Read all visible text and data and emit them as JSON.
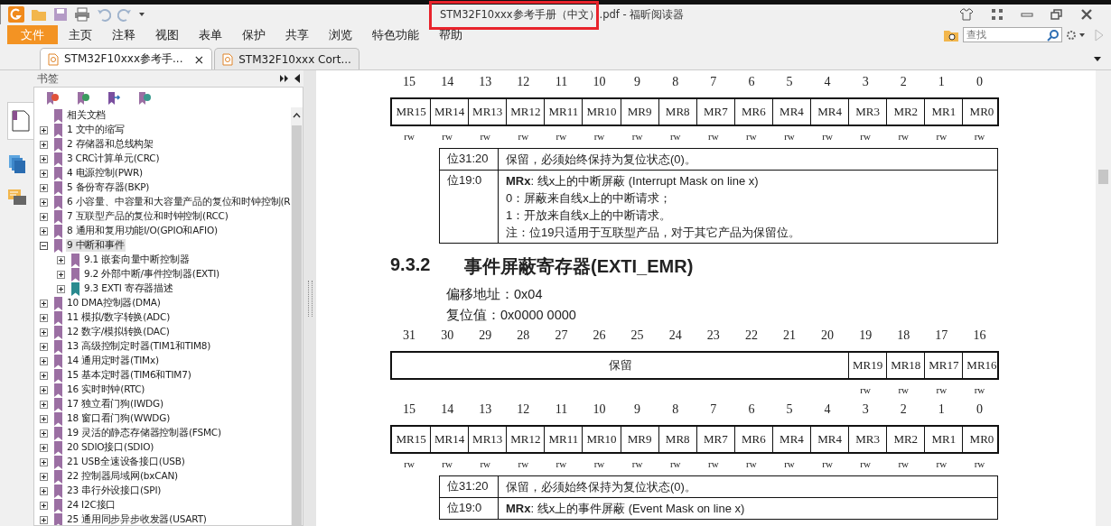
{
  "window": {
    "title": "STM32F10xxx参考手册（中文）.pdf - 福昕阅读器"
  },
  "menu": [
    {
      "label": "文件",
      "kind": "file",
      "selected": false
    },
    {
      "label": "主页",
      "kind": "tab",
      "selected": false
    },
    {
      "label": "注释",
      "kind": "tab",
      "selected": false
    },
    {
      "label": "视图",
      "kind": "tab",
      "selected": false
    },
    {
      "label": "表单",
      "kind": "tab",
      "selected": false
    },
    {
      "label": "保护",
      "kind": "tab",
      "selected": false
    },
    {
      "label": "共享",
      "kind": "tab",
      "selected": false
    },
    {
      "label": "浏览",
      "kind": "tab",
      "selected": false
    },
    {
      "label": "特色功能",
      "kind": "tab",
      "selected": false
    },
    {
      "label": "帮助",
      "kind": "tab",
      "selected": false
    }
  ],
  "search": {
    "placeholder": "查找"
  },
  "doc_tabs": [
    {
      "label": "STM32F10xxx参考手...",
      "selected": true,
      "close": "×"
    },
    {
      "label": "STM32F10xxx Cort...",
      "selected": false
    }
  ],
  "sidebar": {
    "title": "书签",
    "bookmarks": [
      {
        "label": "相关文档",
        "expandable": false,
        "selected": false,
        "color": "#9b6fa3"
      },
      {
        "label": "1 文中的缩写",
        "expandable": true,
        "expanded": false,
        "selected": false,
        "color": "#9b6fa3"
      },
      {
        "label": "2 存储器和总线构架",
        "expandable": true,
        "expanded": false,
        "selected": false,
        "color": "#9b6fa3"
      },
      {
        "label": "3 CRC计算单元(CRC)",
        "expandable": true,
        "expanded": false,
        "selected": false,
        "color": "#9b6fa3"
      },
      {
        "label": "4 电源控制(PWR)",
        "expandable": true,
        "expanded": false,
        "selected": false,
        "color": "#9b6fa3"
      },
      {
        "label": "5 备份寄存器(BKP)",
        "expandable": true,
        "expanded": false,
        "selected": false,
        "color": "#9b6fa3"
      },
      {
        "label": "6 小容量、中容量和大容量产品的复位和时钟控制(R",
        "expandable": true,
        "expanded": false,
        "selected": false,
        "color": "#9b6fa3"
      },
      {
        "label": "7 互联型产品的复位和时钟控制(RCC)",
        "expandable": true,
        "expanded": false,
        "selected": false,
        "color": "#9b6fa3"
      },
      {
        "label": "8 通用和复用功能I/O(GPIO和AFIO)",
        "expandable": true,
        "expanded": false,
        "selected": false,
        "color": "#9b6fa3"
      },
      {
        "label": "9 中断和事件",
        "expandable": true,
        "expanded": true,
        "selected": true,
        "color": "#9b6fa3",
        "children": [
          {
            "label": "9.1 嵌套向量中断控制器",
            "expandable": true,
            "expanded": false,
            "selected": false,
            "color": "#9b6fa3"
          },
          {
            "label": "9.2 外部中断/事件控制器(EXTI)",
            "expandable": true,
            "expanded": false,
            "selected": false,
            "color": "#9b6fa3"
          },
          {
            "label": "9.3 EXTI 寄存器描述",
            "expandable": true,
            "expanded": false,
            "selected": false,
            "color": "#2a8a8f"
          }
        ]
      },
      {
        "label": "10 DMA控制器(DMA)",
        "expandable": true,
        "expanded": false,
        "selected": false,
        "color": "#9b6fa3"
      },
      {
        "label": "11 模拟/数字转换(ADC)",
        "expandable": true,
        "expanded": false,
        "selected": false,
        "color": "#9b6fa3"
      },
      {
        "label": "12 数字/模拟转换(DAC)",
        "expandable": true,
        "expanded": false,
        "selected": false,
        "color": "#9b6fa3"
      },
      {
        "label": "13 高级控制定时器(TIM1和TIM8)",
        "expandable": true,
        "expanded": false,
        "selected": false,
        "color": "#9b6fa3"
      },
      {
        "label": "14 通用定时器(TIMx)",
        "expandable": true,
        "expanded": false,
        "selected": false,
        "color": "#9b6fa3"
      },
      {
        "label": "15 基本定时器(TIM6和TIM7)",
        "expandable": true,
        "expanded": false,
        "selected": false,
        "color": "#9b6fa3"
      },
      {
        "label": "16 实时时钟(RTC)",
        "expandable": true,
        "expanded": false,
        "selected": false,
        "color": "#9b6fa3"
      },
      {
        "label": "17 独立看门狗(IWDG)",
        "expandable": true,
        "expanded": false,
        "selected": false,
        "color": "#9b6fa3"
      },
      {
        "label": "18 窗口看门狗(WWDG)",
        "expandable": true,
        "expanded": false,
        "selected": false,
        "color": "#9b6fa3"
      },
      {
        "label": "19 灵活的静态存储器控制器(FSMC)",
        "expandable": true,
        "expanded": false,
        "selected": false,
        "color": "#9b6fa3"
      },
      {
        "label": "20 SDIO接口(SDIO)",
        "expandable": true,
        "expanded": false,
        "selected": false,
        "color": "#9b6fa3"
      },
      {
        "label": "21 USB全速设备接口(USB)",
        "expandable": true,
        "expanded": false,
        "selected": false,
        "color": "#9b6fa3"
      },
      {
        "label": "22 控制器局域网(bxCAN)",
        "expandable": true,
        "expanded": false,
        "selected": false,
        "color": "#9b6fa3"
      },
      {
        "label": "23 串行外设接口(SPI)",
        "expandable": true,
        "expanded": false,
        "selected": false,
        "color": "#9b6fa3"
      },
      {
        "label": "24 I2C接口",
        "expandable": true,
        "expanded": false,
        "selected": false,
        "color": "#9b6fa3"
      },
      {
        "label": "25 通用同步异步收发器(USART)",
        "expandable": true,
        "expanded": false,
        "selected": false,
        "color": "#9b6fa3"
      }
    ]
  },
  "page": [
    {
      "kind": "register",
      "rows": [
        {
          "fields": [
            {
              "name": "MR15",
              "bits": [
                "15"
              ],
              "access": "rw"
            },
            {
              "name": "MR14",
              "bits": [
                "14"
              ],
              "access": "rw"
            },
            {
              "name": "MR13",
              "bits": [
                "13"
              ],
              "access": "rw"
            },
            {
              "name": "MR12",
              "bits": [
                "12"
              ],
              "access": "rw"
            },
            {
              "name": "MR11",
              "bits": [
                "11"
              ],
              "access": "rw"
            },
            {
              "name": "MR10",
              "bits": [
                "10"
              ],
              "access": "rw"
            },
            {
              "name": "MR9",
              "bits": [
                "9"
              ],
              "access": "rw"
            },
            {
              "name": "MR8",
              "bits": [
                "8"
              ],
              "access": "rw"
            },
            {
              "name": "MR7",
              "bits": [
                "7"
              ],
              "access": "rw"
            },
            {
              "name": "MR6",
              "bits": [
                "6"
              ],
              "access": "rw"
            },
            {
              "name": "MR4",
              "bits": [
                "5"
              ],
              "access": "rw"
            },
            {
              "name": "MR4",
              "bits": [
                "4"
              ],
              "access": "rw"
            },
            {
              "name": "MR3",
              "bits": [
                "3"
              ],
              "access": "rw"
            },
            {
              "name": "MR2",
              "bits": [
                "2"
              ],
              "access": "rw"
            },
            {
              "name": "MR1",
              "bits": [
                "1"
              ],
              "access": "rw"
            },
            {
              "name": "MR0",
              "bits": [
                "0"
              ],
              "access": "rw"
            }
          ]
        }
      ]
    },
    {
      "kind": "field_table",
      "rows": [
        {
          "bits": "位31:20",
          "lines": [
            "保留，必须始终保持为复位状态(0)。"
          ]
        },
        {
          "bits": "位19:0",
          "lines": [
            "**MRx**: 线x上的中断屏蔽 (Interrupt Mask on line x)",
            "0：屏蔽来自线x上的中断请求；",
            "1：开放来自线x上的中断请求。",
            "注：位19只适用于互联型产品，对于其它产品为保留位。"
          ]
        }
      ]
    },
    {
      "kind": "heading",
      "number": "9.3.2",
      "text": "事件屏蔽寄存器(EXTI_EMR)"
    },
    {
      "kind": "text",
      "text": "偏移地址：0x04"
    },
    {
      "kind": "text",
      "text": "复位值：0x0000 0000"
    },
    {
      "kind": "register",
      "rows": [
        {
          "fields": [
            {
              "name": "保留",
              "bits": [
                "31",
                "30",
                "29",
                "28",
                "27",
                "26",
                "25",
                "24",
                "23",
                "22",
                "21",
                "20"
              ]
            },
            {
              "name": "MR19",
              "bits": [
                "19"
              ],
              "access": "rw"
            },
            {
              "name": "MR18",
              "bits": [
                "18"
              ],
              "access": "rw"
            },
            {
              "name": "MR17",
              "bits": [
                "17"
              ],
              "access": "rw"
            },
            {
              "name": "MR16",
              "bits": [
                "16"
              ],
              "access": "rw"
            }
          ]
        },
        {
          "fields": [
            {
              "name": "MR15",
              "bits": [
                "15"
              ],
              "access": "rw"
            },
            {
              "name": "MR14",
              "bits": [
                "14"
              ],
              "access": "rw"
            },
            {
              "name": "MR13",
              "bits": [
                "13"
              ],
              "access": "rw"
            },
            {
              "name": "MR12",
              "bits": [
                "12"
              ],
              "access": "rw"
            },
            {
              "name": "MR11",
              "bits": [
                "11"
              ],
              "access": "rw"
            },
            {
              "name": "MR10",
              "bits": [
                "10"
              ],
              "access": "rw"
            },
            {
              "name": "MR9",
              "bits": [
                "9"
              ],
              "access": "rw"
            },
            {
              "name": "MR8",
              "bits": [
                "8"
              ],
              "access": "rw"
            },
            {
              "name": "MR7",
              "bits": [
                "7"
              ],
              "access": "rw"
            },
            {
              "name": "MR6",
              "bits": [
                "6"
              ],
              "access": "rw"
            },
            {
              "name": "MR4",
              "bits": [
                "5"
              ],
              "access": "rw"
            },
            {
              "name": "MR4",
              "bits": [
                "4"
              ],
              "access": "rw"
            },
            {
              "name": "MR3",
              "bits": [
                "3"
              ],
              "access": "rw"
            },
            {
              "name": "MR2",
              "bits": [
                "2"
              ],
              "access": "rw"
            },
            {
              "name": "MR1",
              "bits": [
                "1"
              ],
              "access": "rw"
            },
            {
              "name": "MR0",
              "bits": [
                "0"
              ],
              "access": "rw"
            }
          ]
        }
      ]
    },
    {
      "kind": "field_table",
      "rows": [
        {
          "bits": "位31:20",
          "lines": [
            "保留，必须始终保持为复位状态(0)。"
          ]
        },
        {
          "bits": "位19:0",
          "lines": [
            "**MRx**: 线x上的事件屏蔽 (Event Mask on line x)"
          ]
        }
      ]
    }
  ]
}
